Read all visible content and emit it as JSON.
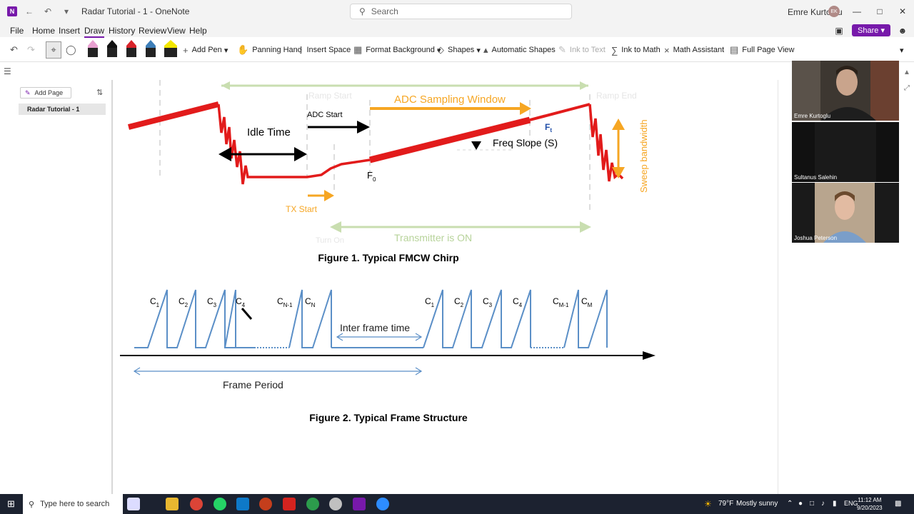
{
  "window": {
    "app_logo": "N",
    "title": "Radar Tutorial - 1  -  OneNote",
    "search_placeholder": "Search",
    "user_name": "Emre Kurtoglu",
    "user_initials": "EK"
  },
  "menu": {
    "items": [
      "File",
      "Home",
      "Insert",
      "Draw",
      "History",
      "Review",
      "View",
      "Help"
    ],
    "active": "Draw",
    "share_label": "Share"
  },
  "ribbon": {
    "add_pen": "Add Pen",
    "panning_hand": "Panning Hand",
    "insert_space": "Insert Space",
    "format_background": "Format Background",
    "shapes": "Shapes",
    "automatic_shapes": "Automatic Shapes",
    "ink_to_text": "Ink to Text",
    "ink_to_math": "Ink to Math",
    "math_assistant": "Math Assistant",
    "full_page_view": "Full Page View",
    "pen_colors": [
      "#e8a0d0",
      "#111111",
      "#d8232a",
      "#3d7eb8",
      "#f2e600"
    ]
  },
  "pages": {
    "add_page_label": "Add Page",
    "items": [
      "Radar Tutorial - 1"
    ]
  },
  "figure1": {
    "caption": "Figure 1. Typical FMCW Chirp",
    "labels": {
      "ramp_start": "Ramp Start",
      "ramp_end": "Ramp End",
      "adc_sampling_window": "ADC Sampling Window",
      "idle_time": "Idle Time",
      "adc_start": "ADC  Start",
      "ft": "F",
      "ft_sub": "t",
      "freq_slope": "Freq Slope (S)",
      "f0": "F",
      "f0_sub": "0",
      "tx_start": "TX Start",
      "turn_on": "Turn On",
      "transmitter_on": "Transmitter is ON",
      "sweep_bandwidth": "Sweep bandwidth"
    }
  },
  "figure2": {
    "caption": "Figure 2. Typical Frame Structure",
    "chirps_left": [
      {
        "c": "C",
        "sub": "1"
      },
      {
        "c": "C",
        "sub": "2"
      },
      {
        "c": "C",
        "sub": "3"
      },
      {
        "c": "C",
        "sub": "4"
      },
      {
        "c": "C",
        "sub": "N-1"
      },
      {
        "c": "C",
        "sub": "N"
      }
    ],
    "chirps_right": [
      {
        "c": "C",
        "sub": "1"
      },
      {
        "c": "C",
        "sub": "2"
      },
      {
        "c": "C",
        "sub": "3"
      },
      {
        "c": "C",
        "sub": "4"
      },
      {
        "c": "C",
        "sub": "M-1"
      },
      {
        "c": "C",
        "sub": "M"
      }
    ],
    "inter_frame_time": "Inter frame time",
    "frame_period": "Frame Period"
  },
  "participants": [
    {
      "name": "Emre Kurtoglu",
      "bg": "#4a4038"
    },
    {
      "name": "Sultanus Salehin",
      "bg": "#141414"
    },
    {
      "name": "Joshua Peterson",
      "bg": "#1a1a1a"
    }
  ],
  "taskbar": {
    "search_placeholder": "Type here to search",
    "weather_temp": "79°F",
    "weather_text": "Mostly sunny",
    "lang": "ENG",
    "time": "11:12 AM",
    "date": "9/20/2023"
  }
}
